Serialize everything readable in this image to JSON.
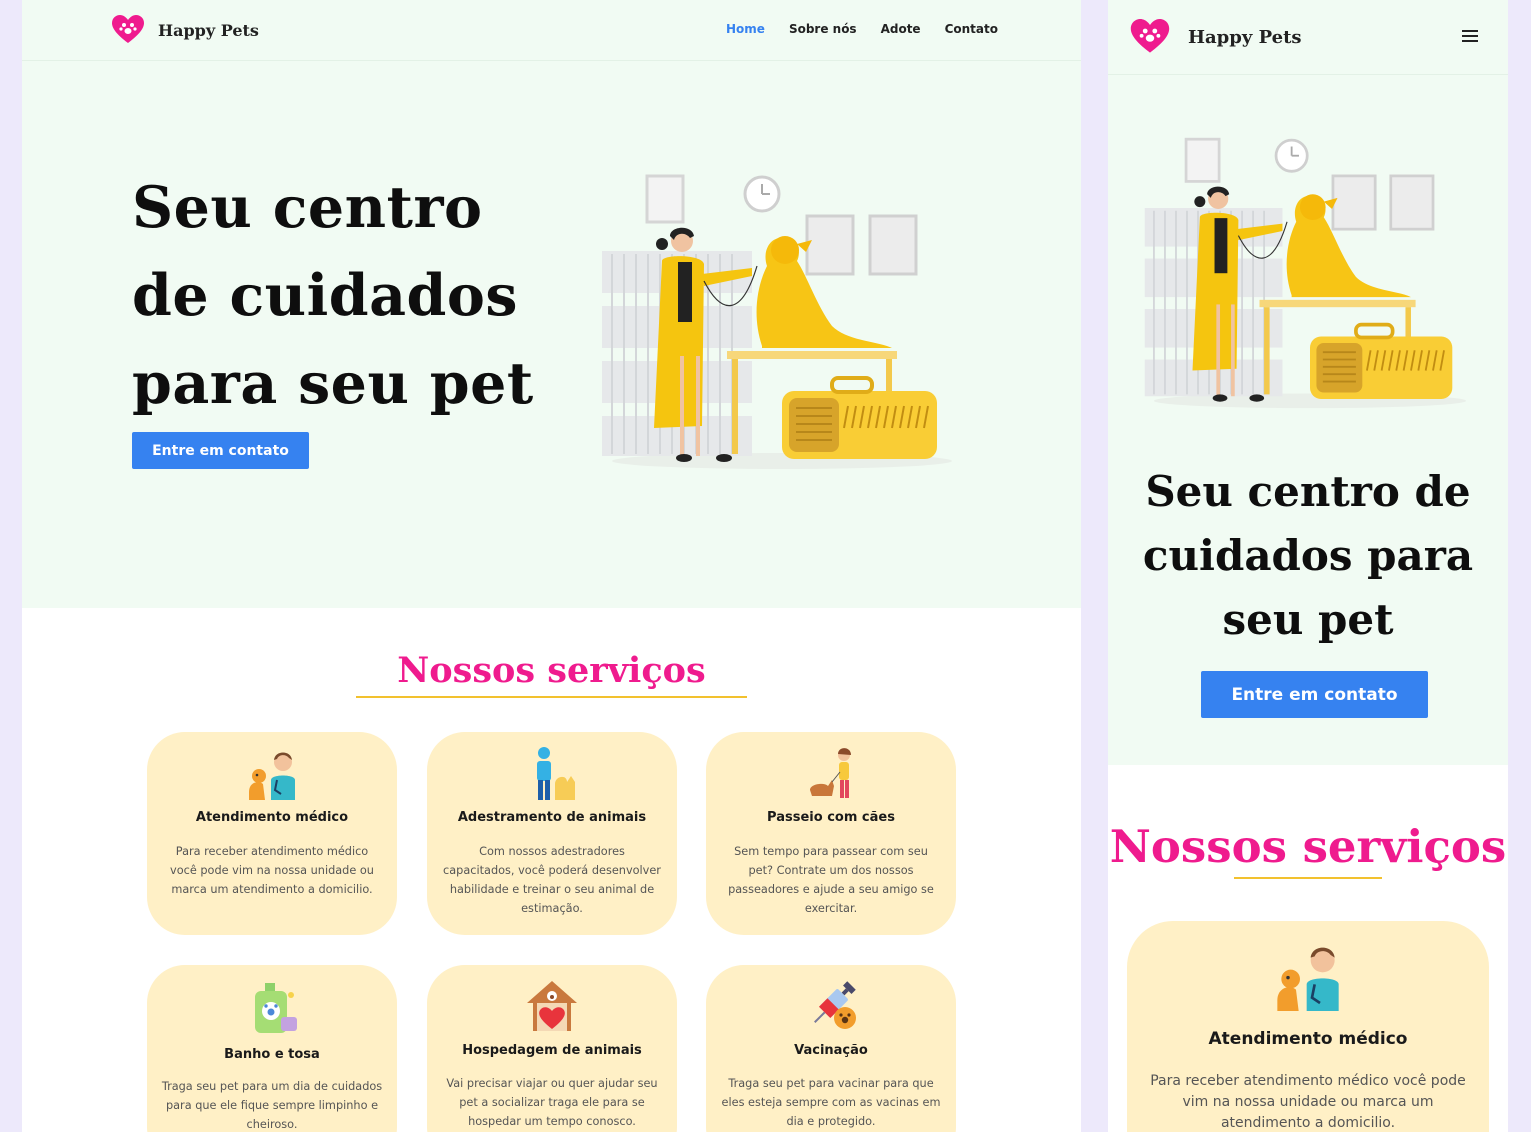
{
  "brand": {
    "name": "Happy Pets"
  },
  "nav": {
    "items": [
      {
        "label": "Home",
        "active": true
      },
      {
        "label": "Sobre nós"
      },
      {
        "label": "Adote"
      },
      {
        "label": "Contato"
      }
    ]
  },
  "hero": {
    "title": "Seu centro de cuidados para seu pet",
    "cta": "Entre em contato"
  },
  "services": {
    "title": "Nossos serviços",
    "items": [
      {
        "icon": "vet-icon",
        "title": "Atendimento médico",
        "text": "Para receber atendimento médico você pode vim na nossa unidade ou marca um atendimento a domicilio."
      },
      {
        "icon": "training-icon",
        "title": "Adestramento de animais",
        "text": "Com nossos adestradores capacitados, você poderá desenvolver habilidade e treinar o seu animal de estimação."
      },
      {
        "icon": "dog-walk-icon",
        "title": "Passeio com cães",
        "text": "Sem tempo para passear com seu pet? Contrate um dos nossos passeadores e ajude a seu amigo se exercitar."
      },
      {
        "icon": "grooming-icon",
        "title": "Banho e tosa",
        "text": "Traga seu pet para um dia de cuidados para que ele fique sempre limpinho e cheiroso."
      },
      {
        "icon": "pet-house-icon",
        "title": "Hospedagem de animais",
        "text": "Vai precisar viajar ou quer ajudar seu pet a socializar traga ele para se hospedar um tempo conosco."
      },
      {
        "icon": "vaccine-icon",
        "title": "Vacinação",
        "text": "Traga seu pet para vacinar para que eles esteja sempre com as vacinas em dia e protegido."
      }
    ]
  },
  "colors": {
    "accent": "#3682f0",
    "brand_pink": "#ef1b8e",
    "card_bg": "#fff0c6",
    "hero_bg": "#f1fbf3",
    "underline": "#f2c12e"
  }
}
